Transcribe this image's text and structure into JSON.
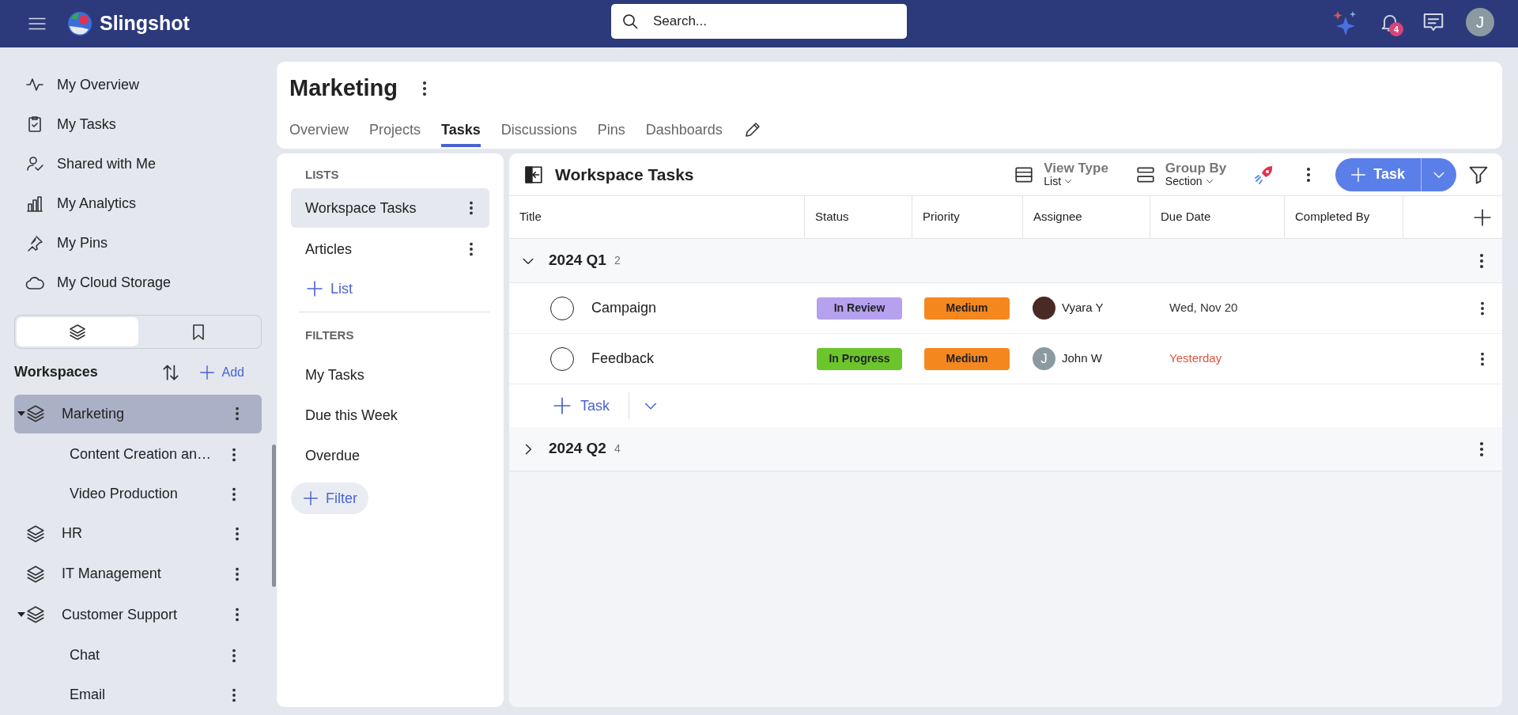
{
  "topbar": {
    "brand": "Slingshot",
    "search_placeholder": "Search...",
    "notification_count": "4",
    "avatar_initial": "J"
  },
  "nav": [
    {
      "kind": "overview",
      "label": "My Overview"
    },
    {
      "kind": "tasks",
      "label": "My Tasks"
    },
    {
      "kind": "shared",
      "label": "Shared with Me"
    },
    {
      "kind": "analytics",
      "label": "My Analytics"
    },
    {
      "kind": "pins",
      "label": "My Pins"
    },
    {
      "kind": "cloud",
      "label": "My Cloud Storage"
    }
  ],
  "sidebar_tabs": [
    {
      "kind": "workspaces",
      "selected": true
    },
    {
      "kind": "bookmarks",
      "selected": false
    }
  ],
  "workspaces": {
    "title": "Workspaces",
    "add_label": "Add",
    "items": [
      {
        "label": "Marketing",
        "selected": true,
        "expanded": true,
        "children": [
          {
            "label": "Content Creation an…"
          },
          {
            "label": "Video Production"
          }
        ]
      },
      {
        "label": "HR",
        "selected": false,
        "expanded": false
      },
      {
        "label": "IT Management",
        "selected": false,
        "expanded": false
      },
      {
        "label": "Customer Support",
        "selected": false,
        "expanded": true,
        "children": [
          {
            "label": "Chat"
          },
          {
            "label": "Email"
          }
        ]
      }
    ]
  },
  "page": {
    "title": "Marketing",
    "tabs": [
      {
        "label": "Overview",
        "selected": false
      },
      {
        "label": "Projects",
        "selected": false
      },
      {
        "label": "Tasks",
        "selected": true
      },
      {
        "label": "Discussions",
        "selected": false
      },
      {
        "label": "Pins",
        "selected": false
      },
      {
        "label": "Dashboards",
        "selected": false
      }
    ]
  },
  "lists_panel": {
    "lists_heading": "LISTS",
    "lists": [
      {
        "label": "Workspace Tasks",
        "selected": true
      },
      {
        "label": "Articles",
        "selected": false
      }
    ],
    "add_list": "List",
    "filters_heading": "FILTERS",
    "filters": [
      {
        "label": "My Tasks"
      },
      {
        "label": "Due this Week"
      },
      {
        "label": "Overdue"
      }
    ],
    "add_filter": "Filter"
  },
  "tasks_panel": {
    "title": "Workspace Tasks",
    "view_type": {
      "label": "View Type",
      "value": "List"
    },
    "group_by": {
      "label": "Group By",
      "value": "Section"
    },
    "new_task": "Task",
    "columns": [
      "Title",
      "Status",
      "Priority",
      "Assignee",
      "Due Date",
      "Completed By"
    ],
    "groups": [
      {
        "name": "2024 Q1",
        "count": "2",
        "expanded": true,
        "add_task": "Task",
        "tasks": [
          {
            "title": "Campaign",
            "done": false,
            "status": {
              "label": "In Review",
              "color": "#b5a1ee"
            },
            "priority": {
              "label": "Medium",
              "color": "#f5871f"
            },
            "assignee": {
              "kind": "photo",
              "name": "Vyara Y"
            },
            "due": {
              "text": "Wed, Nov 20",
              "overdue": false
            }
          },
          {
            "title": "Feedback",
            "done": false,
            "status": {
              "label": "In Progress",
              "color": "#6cc52b"
            },
            "priority": {
              "label": "Medium",
              "color": "#f5871f"
            },
            "assignee": {
              "kind": "initial",
              "initial": "J",
              "name": "John W"
            },
            "due": {
              "text": "Yesterday",
              "overdue": true
            }
          }
        ]
      },
      {
        "name": "2024 Q2",
        "count": "4",
        "expanded": false
      }
    ]
  }
}
